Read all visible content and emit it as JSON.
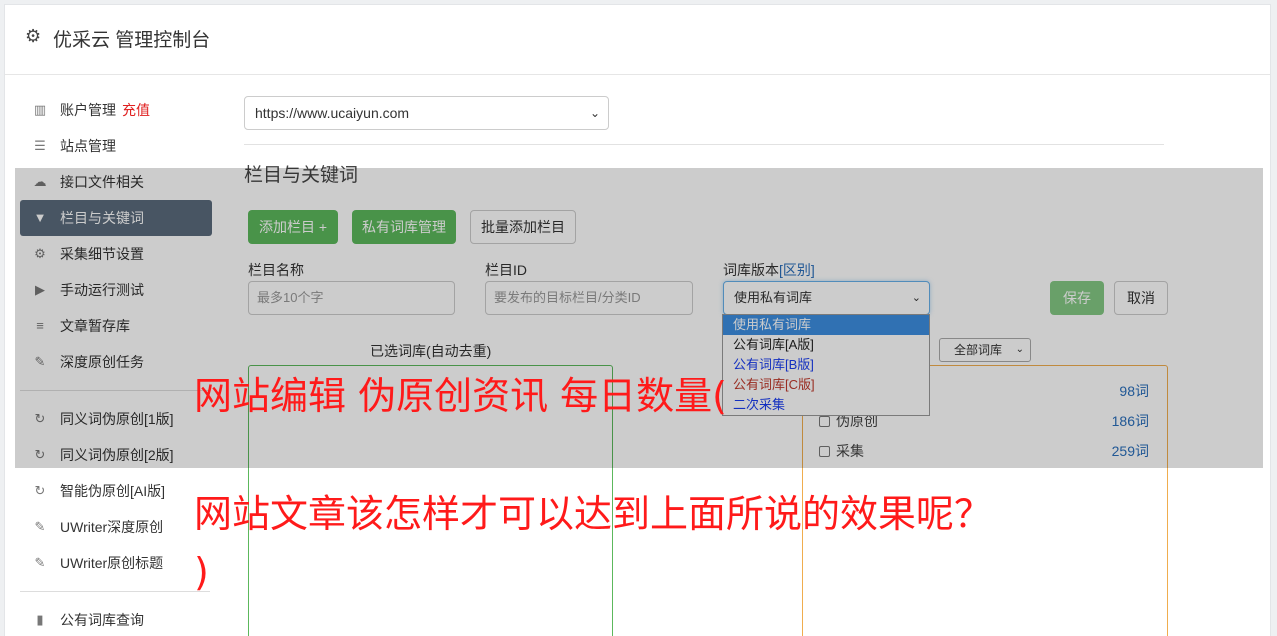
{
  "header": {
    "title": "优采云 管理控制台",
    "icon": "gear-icon"
  },
  "sidebar": {
    "items": [
      {
        "label": "账户管理",
        "badge": "充值",
        "icon": "bar-chart-icon"
      },
      {
        "label": "站点管理",
        "icon": "server-icon"
      },
      {
        "label": "接口文件相关",
        "icon": "cloud-upload-icon"
      },
      {
        "label": "栏目与关键词",
        "icon": "filter-icon",
        "active": true
      },
      {
        "label": "采集细节设置",
        "icon": "cogs-icon"
      },
      {
        "label": "手动运行测试",
        "icon": "play-circle-icon"
      },
      {
        "label": "文章暂存库",
        "icon": "database-icon"
      },
      {
        "label": "深度原创任务",
        "icon": "edit-icon"
      }
    ],
    "items2": [
      {
        "label": "同义词伪原创[1版]",
        "icon": "refresh-icon"
      },
      {
        "label": "同义词伪原创[2版]",
        "icon": "refresh-icon"
      },
      {
        "label": "智能伪原创[AI版]",
        "icon": "refresh-icon"
      },
      {
        "label": "UWriter深度原创",
        "icon": "edit-icon"
      },
      {
        "label": "UWriter原创标题",
        "icon": "edit-icon"
      }
    ],
    "items3": [
      {
        "label": "公有词库查询",
        "icon": "book-icon"
      }
    ]
  },
  "main": {
    "site_select": "https://www.ucaiyun.com",
    "section_title": "栏目与关键词",
    "buttons": {
      "add_column": "添加栏目 +",
      "private_lib": "私有词库管理",
      "batch_add": "批量添加栏目",
      "save": "保存",
      "cancel": "取消"
    },
    "form": {
      "name_label": "栏目名称",
      "name_placeholder": "最多10个字",
      "id_label": "栏目ID",
      "id_placeholder": "要发布的目标栏目/分类ID",
      "version_label": "词库版本",
      "version_link": "[区别]",
      "version_value": "使用私有词库",
      "options": [
        "使用私有词库",
        "公有词库[A版]",
        "公有词库[B版]",
        "公有词库[C版]",
        "二次采集"
      ]
    },
    "selected_label": "已选词库(自动去重)",
    "filter_value": "全部词库",
    "libraries": [
      {
        "name": "",
        "count": "98词"
      },
      {
        "name": "伪原创",
        "count": "186词"
      },
      {
        "name": "采集",
        "count": "259词"
      }
    ]
  },
  "caption": {
    "line1": "网站编辑 伪原创资讯 每日数量(",
    "line2": "网站文章该怎样才可以达到上面所说的效果呢？",
    "line3": ")"
  }
}
